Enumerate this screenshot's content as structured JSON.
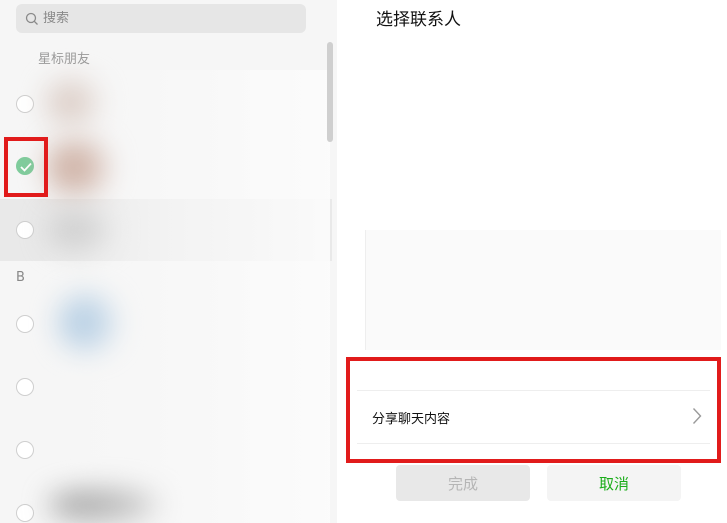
{
  "search": {
    "placeholder": "搜索",
    "icon": "search-icon"
  },
  "contacts": {
    "group_label": "星标朋友",
    "section_letter": "B"
  },
  "dialog": {
    "title": "选择联系人",
    "share_chat_label": "分享聊天内容",
    "done_label": "完成",
    "cancel_label": "取消"
  },
  "colors": {
    "highlight": "#e11b1b",
    "check": "#7fcc9c",
    "cancel_text": "#1aad19"
  }
}
